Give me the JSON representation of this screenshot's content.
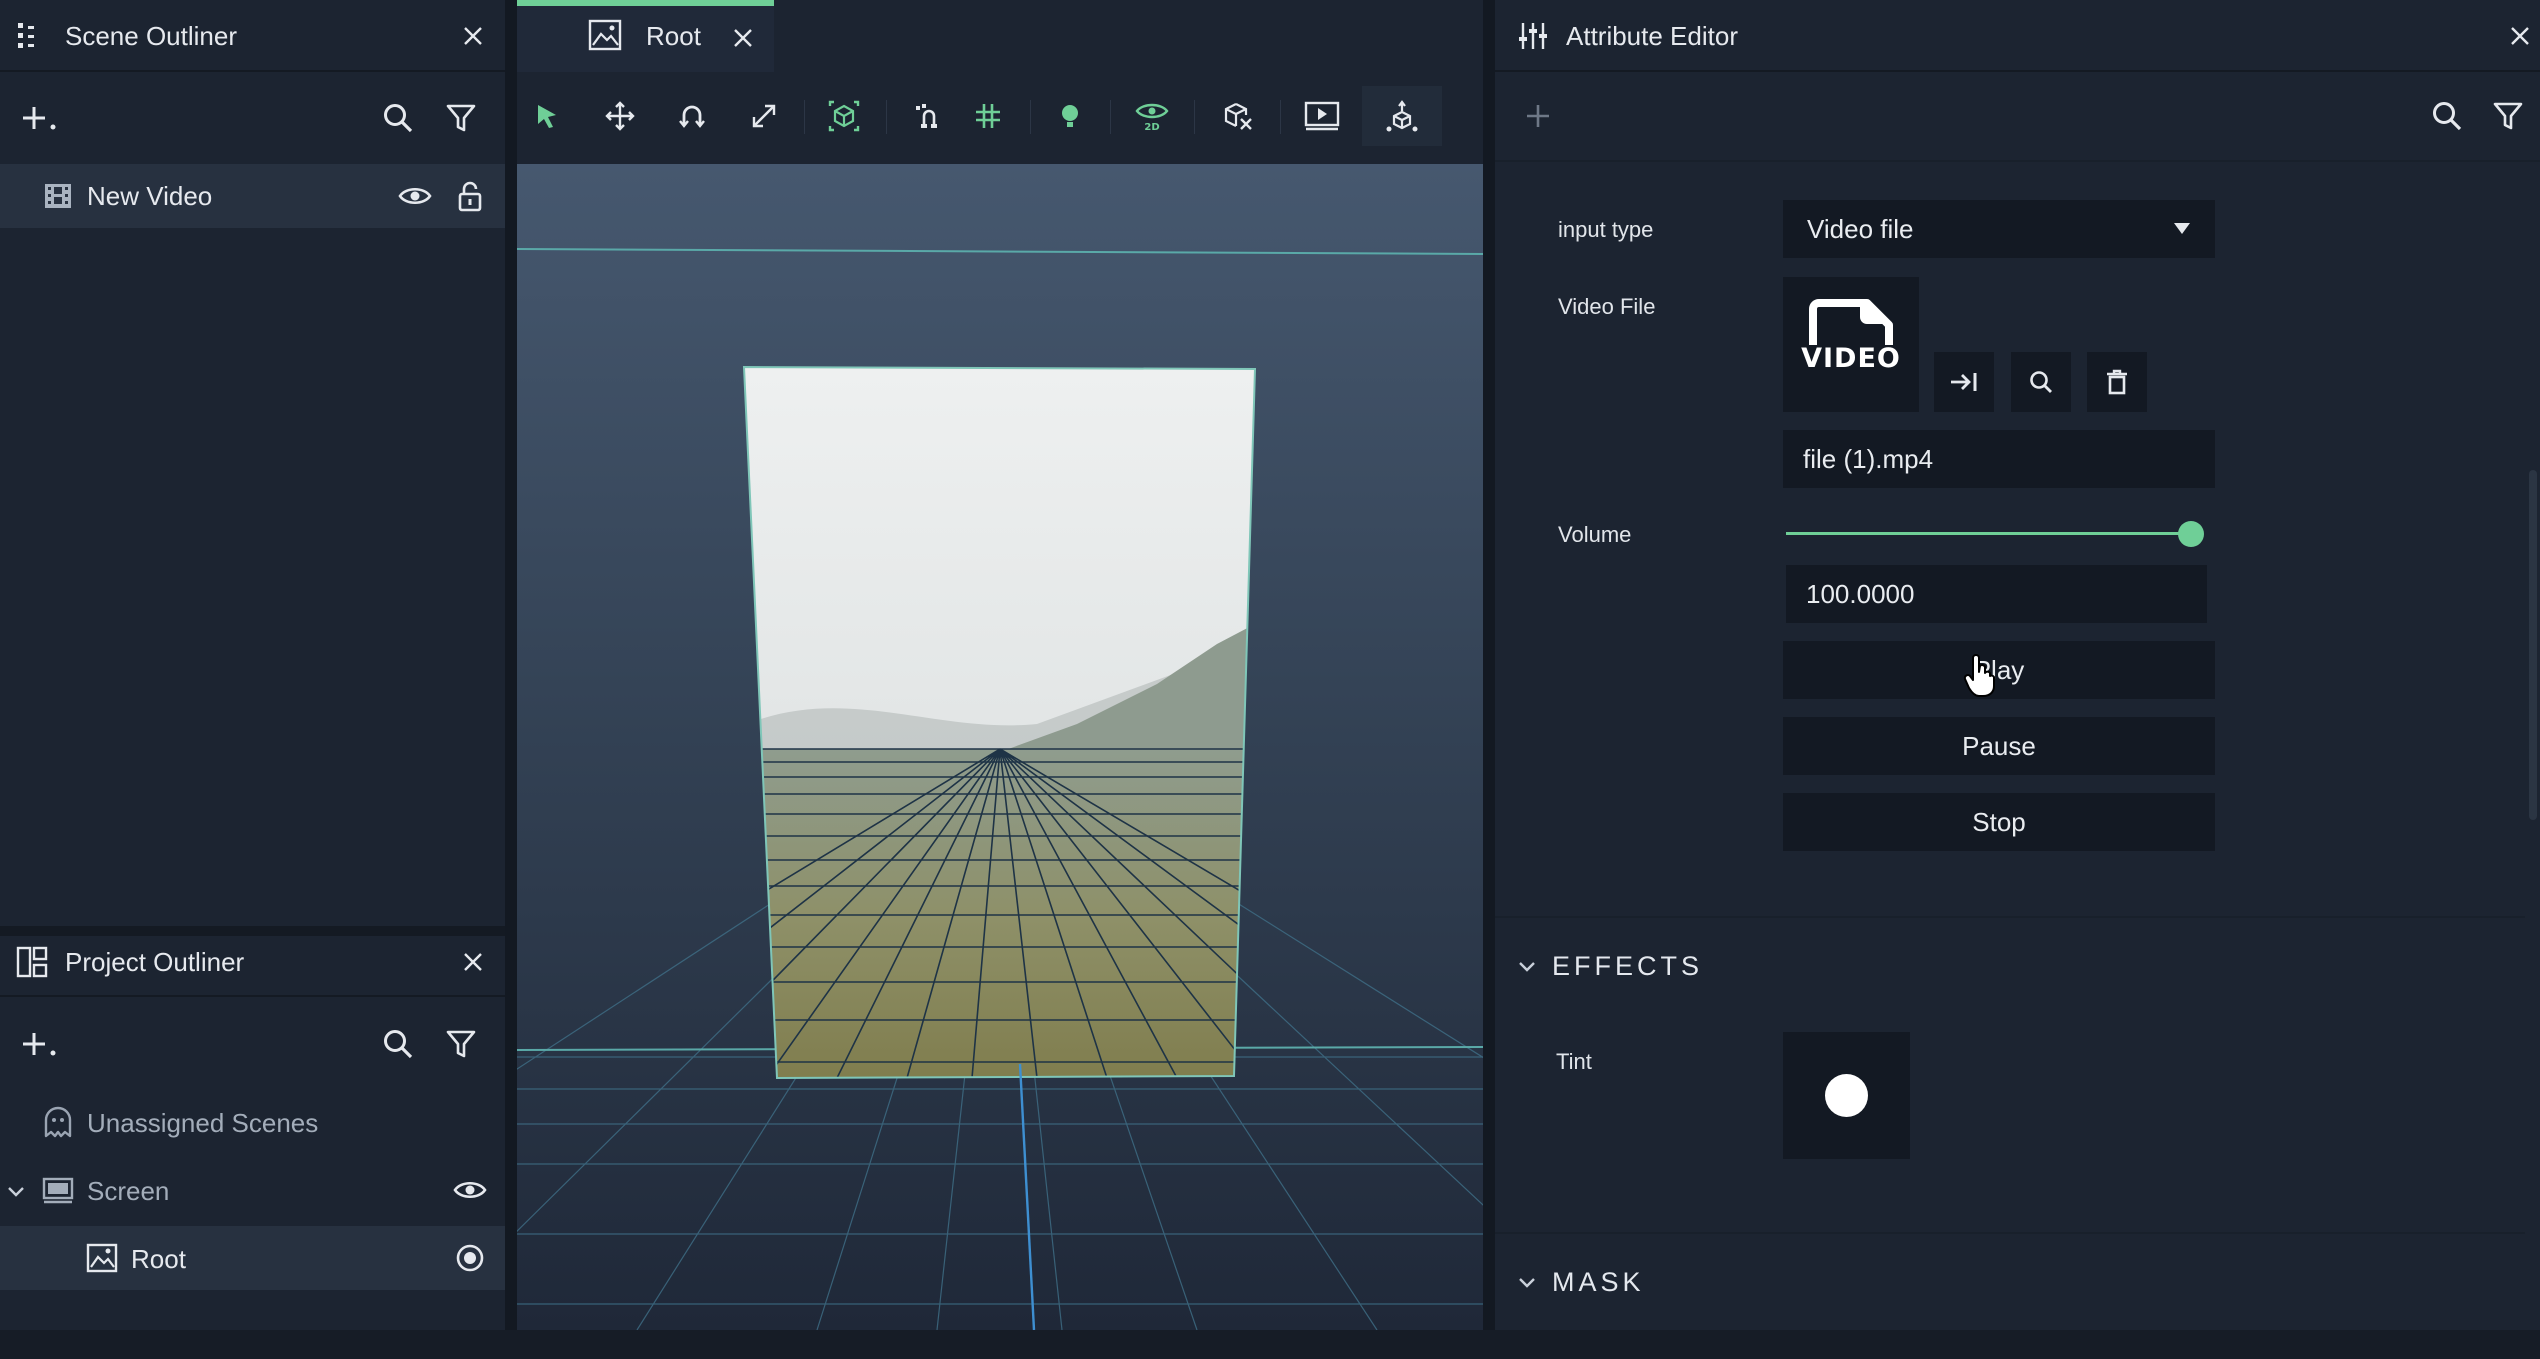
{
  "colors": {
    "accent": "#6fcf97",
    "panel_bg": "#1c2431",
    "field_bg": "#131923",
    "selected_row": "#273140"
  },
  "scene_outliner": {
    "title": "Scene Outliner",
    "items": [
      {
        "label": "New Video",
        "icon": "film-icon"
      }
    ]
  },
  "project_outliner": {
    "title": "Project Outliner",
    "items": [
      {
        "label": "Unassigned Scenes",
        "icon": "ghost-icon"
      },
      {
        "label": "Screen",
        "icon": "monitor-icon"
      },
      {
        "label": "Root",
        "icon": "image-icon"
      }
    ]
  },
  "viewport": {
    "tab_label": "Root",
    "toolbar": [
      "select-tool",
      "move-tool",
      "rotate-tool",
      "scale-tool",
      "bounding-box-tool",
      "snap-tool",
      "grid-tool",
      "light-tool",
      "2d-view-tool",
      "3d-view-tool",
      "preview-tool",
      "gizmo-tool"
    ]
  },
  "attribute_editor": {
    "title": "Attribute Editor",
    "input_type_label": "input type",
    "input_type_value": "Video file",
    "video_file_label": "Video File",
    "video_thumb_text": "VIDEO",
    "filename": "file (1).mp4",
    "volume_label": "Volume",
    "volume_value": "100.0000",
    "volume_level": 1.0,
    "play_label": "Play",
    "pause_label": "Pause",
    "stop_label": "Stop",
    "effects_label": "EFFECTS",
    "tint_label": "Tint",
    "mask_label": "MASK"
  }
}
